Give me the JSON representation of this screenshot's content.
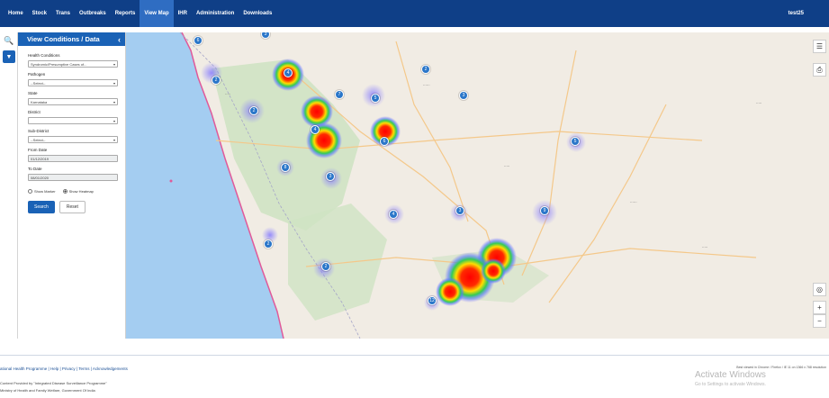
{
  "nav": {
    "items": [
      "Home",
      "Stock",
      "Trans",
      "Outbreaks",
      "Reports",
      "View Map",
      "IHR",
      "Administration",
      "Downloads"
    ],
    "active_index": 5,
    "user": "test25"
  },
  "panel": {
    "title": "View Conditions / Data",
    "fields": {
      "health_condition": {
        "label": "Health Conditions",
        "value": "Syndromic/Presumptive Cases of..."
      },
      "pathogen": {
        "label": "Pathogen",
        "value": "--Select--"
      },
      "state": {
        "label": "State",
        "value": "Karnataka"
      },
      "district": {
        "label": "District",
        "value": ""
      },
      "sub_district": {
        "label": "Sub-District",
        "value": "--Select--"
      },
      "from_date": {
        "label": "From Date",
        "value": "01/12/2019"
      },
      "to_date": {
        "label": "To Date",
        "value": "08/01/2020"
      }
    },
    "radios": [
      {
        "label": "Show Marker",
        "selected": false
      },
      {
        "label": "Show Heatmap",
        "selected": true
      }
    ],
    "search_label": "Search",
    "reset_label": "Reset"
  },
  "map": {
    "markers": [
      {
        "label": "6"
      },
      {
        "label": "3"
      },
      {
        "label": "2"
      },
      {
        "label": "4"
      },
      {
        "label": "2"
      },
      {
        "label": "7"
      },
      {
        "label": "5"
      },
      {
        "label": "2"
      },
      {
        "label": "3"
      },
      {
        "label": "4"
      },
      {
        "label": "6"
      },
      {
        "label": "8"
      },
      {
        "label": "3"
      },
      {
        "label": "5"
      },
      {
        "label": "2"
      },
      {
        "label": "4"
      },
      {
        "label": "3"
      },
      {
        "label": "2"
      },
      {
        "label": "9"
      },
      {
        "label": "12"
      }
    ],
    "controls": {
      "layers": "layers-icon",
      "print": "print-icon",
      "locate": "locate-icon",
      "zoom_in": "+",
      "zoom_out": "−"
    }
  },
  "footer": {
    "links": "ational Health Programme | Help | Privacy | Terms | Acknowledgements",
    "line1": "Content Provided by \"Integrated Disease Surveillance Programme\"",
    "line2": "Ministry of Health and Family Welfare, Government Of India",
    "right": "Best viewed in Chrome / Firefox / IE 11 on 1366 x 768 resolution",
    "activate_title": "Activate Windows",
    "activate_sub": "Go to Settings to activate Windows."
  }
}
